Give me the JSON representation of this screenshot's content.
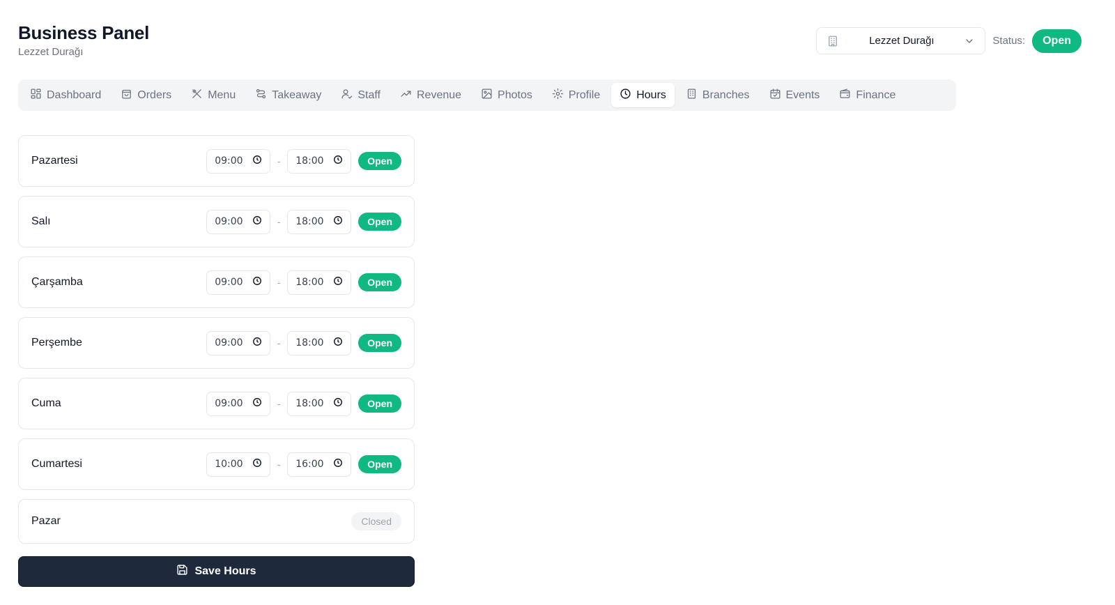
{
  "header": {
    "title": "Business Panel",
    "subtitle": "Lezzet Durağı"
  },
  "branch_select": {
    "value": "Lezzet Durağı",
    "icon": "building-icon"
  },
  "status": {
    "label": "Status:",
    "value": "Open",
    "color": "#10b981"
  },
  "tabs": [
    {
      "label": "Dashboard",
      "icon": "grid-icon",
      "active": false
    },
    {
      "label": "Orders",
      "icon": "bag-icon",
      "active": false
    },
    {
      "label": "Menu",
      "icon": "utensils-icon",
      "active": false
    },
    {
      "label": "Takeaway",
      "icon": "route-icon",
      "active": false
    },
    {
      "label": "Staff",
      "icon": "user-check-icon",
      "active": false
    },
    {
      "label": "Revenue",
      "icon": "trending-up-icon",
      "active": false
    },
    {
      "label": "Photos",
      "icon": "image-icon",
      "active": false
    },
    {
      "label": "Profile",
      "icon": "gear-icon",
      "active": false
    },
    {
      "label": "Hours",
      "icon": "clock-icon",
      "active": true
    },
    {
      "label": "Branches",
      "icon": "building-icon",
      "active": false
    },
    {
      "label": "Events",
      "icon": "calendar-icon",
      "active": false
    },
    {
      "label": "Finance",
      "icon": "wallet-icon",
      "active": false
    }
  ],
  "days": [
    {
      "name": "Pazartesi",
      "open_time": "09:00",
      "close_time": "18:00",
      "separator": "-",
      "status": "Open"
    },
    {
      "name": "Salı",
      "open_time": "09:00",
      "close_time": "18:00",
      "separator": "-",
      "status": "Open"
    },
    {
      "name": "Çarşamba",
      "open_time": "09:00",
      "close_time": "18:00",
      "separator": "-",
      "status": "Open"
    },
    {
      "name": "Perşembe",
      "open_time": "09:00",
      "close_time": "18:00",
      "separator": "-",
      "status": "Open"
    },
    {
      "name": "Cuma",
      "open_time": "09:00",
      "close_time": "18:00",
      "separator": "-",
      "status": "Open"
    },
    {
      "name": "Cumartesi",
      "open_time": "10:00",
      "close_time": "16:00",
      "separator": "-",
      "status": "Open"
    },
    {
      "name": "Pazar",
      "status": "Closed"
    }
  ],
  "save_button": {
    "label": "Save Hours",
    "icon": "save-icon"
  },
  "colors": {
    "accent_green": "#10b981",
    "button_dark": "#1e293b"
  }
}
